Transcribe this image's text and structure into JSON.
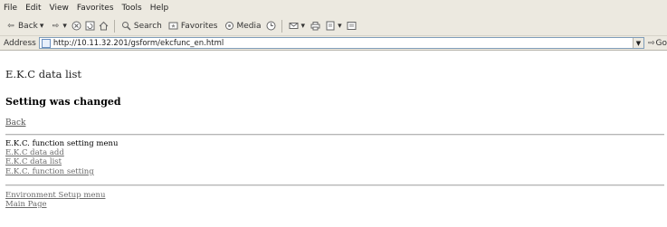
{
  "menu": [
    "File",
    "Edit",
    "View",
    "Favorites",
    "Tools",
    "Help"
  ],
  "toolbar": {
    "back": "Back",
    "search": "Search",
    "favorites": "Favorites",
    "media": "Media"
  },
  "address": {
    "label": "Address",
    "url": "http://10.11.32.201/gsform/ekcfunc_en.html",
    "go": "Go"
  },
  "page": {
    "title": "E.K.C data list",
    "message": "Setting was changed",
    "back_link": "Back",
    "section_label": "E.K.C. function setting menu",
    "links": [
      "E.K.C data add",
      "E.K.C data list",
      "E.K.C. function setting"
    ],
    "footer_links": [
      "Environment Setup menu",
      "Main Page"
    ]
  }
}
